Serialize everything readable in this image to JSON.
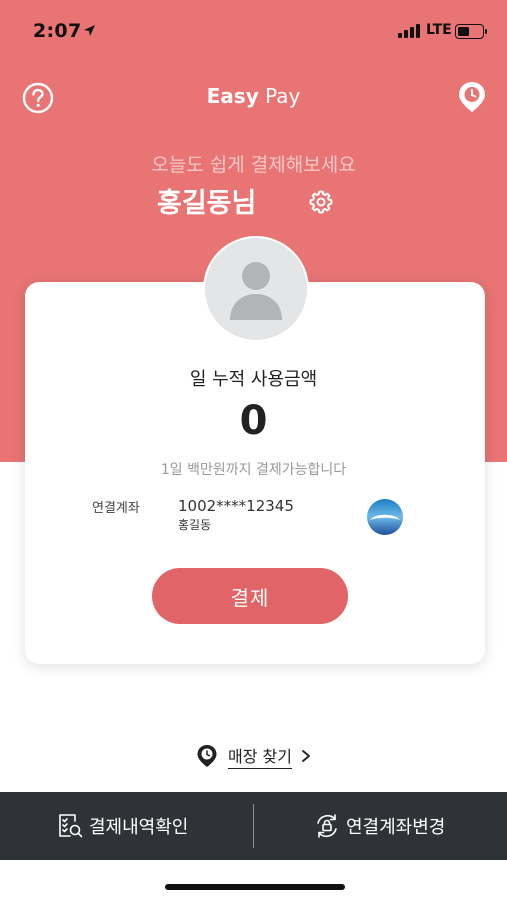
{
  "status_bar": {
    "time": "2:07",
    "network": "LTE"
  },
  "nav": {
    "title_bold": "Easy",
    "title_regular": "Pay",
    "help_icon": "question-circle-icon",
    "location_icon": "location-pin-icon"
  },
  "header": {
    "greeting": "오늘도 쉽게 결제해보세요",
    "user_name": "홍길동님",
    "settings_icon": "gear-icon"
  },
  "card": {
    "avatar_icon": "user-silhouette-icon",
    "daily_label": "일 누적 사용금액",
    "amount": "0",
    "limit_note": "1일 백만원까지 결제가능합니다",
    "account_label": "연결계좌",
    "account_number": "1002****12345",
    "account_holder": "홍길동",
    "bank_logo_icon": "bank-logo-icon",
    "pay_button": "결제"
  },
  "find_store": {
    "label": "매장 찾기",
    "icon": "clock-pin-icon"
  },
  "bottom_bar": {
    "history_label": "결제내역확인",
    "history_icon": "receipt-search-icon",
    "change_account_label": "연결계좌변경",
    "change_account_icon": "refresh-lock-icon"
  },
  "colors": {
    "hero": "#e87474",
    "pay_button": "#e16466",
    "bottom_bar": "#2f3236"
  }
}
